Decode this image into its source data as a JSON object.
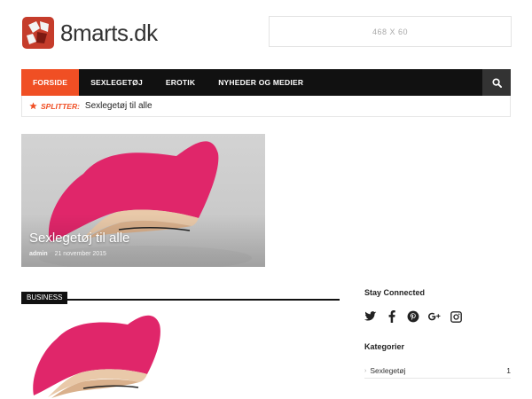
{
  "header": {
    "logo_text": "8marts.dk",
    "ad_label": "468 X 60"
  },
  "nav": {
    "items": [
      "FORSIDE",
      "SEXLEGETØJ",
      "EROTIK",
      "NYHEDER OG MEDIER"
    ],
    "active_index": 0,
    "search_icon": "search-icon"
  },
  "ticker": {
    "label": "SPLITTER:",
    "text": "Sexlegetøj til alle"
  },
  "featured": {
    "title": "Sexlegetøj til alle",
    "author": "admin",
    "date": "21 november 2015"
  },
  "business": {
    "tag": "BUSINESS"
  },
  "sidebar": {
    "stay_connected_title": "Stay Connected",
    "socials": [
      "twitter-icon",
      "facebook-icon",
      "pinterest-icon",
      "google-plus-icon",
      "instagram-icon"
    ],
    "categories_title": "Kategorier",
    "categories": [
      {
        "name": "Sexlegetøj",
        "count": "1"
      }
    ]
  },
  "colors": {
    "accent": "#f04f24",
    "nav_bg": "#111111",
    "product_pink": "#e0266a"
  }
}
